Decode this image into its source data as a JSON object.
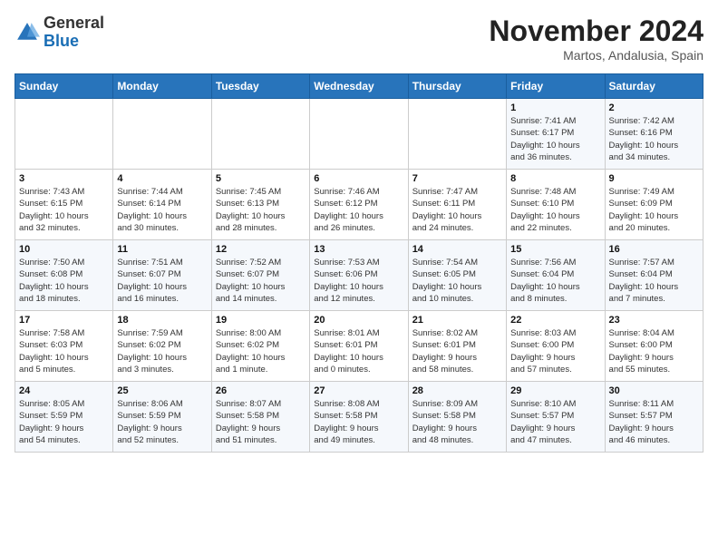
{
  "header": {
    "logo_general": "General",
    "logo_blue": "Blue",
    "month": "November 2024",
    "location": "Martos, Andalusia, Spain"
  },
  "days_of_week": [
    "Sunday",
    "Monday",
    "Tuesday",
    "Wednesday",
    "Thursday",
    "Friday",
    "Saturday"
  ],
  "weeks": [
    [
      {
        "day": "",
        "info": ""
      },
      {
        "day": "",
        "info": ""
      },
      {
        "day": "",
        "info": ""
      },
      {
        "day": "",
        "info": ""
      },
      {
        "day": "",
        "info": ""
      },
      {
        "day": "1",
        "info": "Sunrise: 7:41 AM\nSunset: 6:17 PM\nDaylight: 10 hours\nand 36 minutes."
      },
      {
        "day": "2",
        "info": "Sunrise: 7:42 AM\nSunset: 6:16 PM\nDaylight: 10 hours\nand 34 minutes."
      }
    ],
    [
      {
        "day": "3",
        "info": "Sunrise: 7:43 AM\nSunset: 6:15 PM\nDaylight: 10 hours\nand 32 minutes."
      },
      {
        "day": "4",
        "info": "Sunrise: 7:44 AM\nSunset: 6:14 PM\nDaylight: 10 hours\nand 30 minutes."
      },
      {
        "day": "5",
        "info": "Sunrise: 7:45 AM\nSunset: 6:13 PM\nDaylight: 10 hours\nand 28 minutes."
      },
      {
        "day": "6",
        "info": "Sunrise: 7:46 AM\nSunset: 6:12 PM\nDaylight: 10 hours\nand 26 minutes."
      },
      {
        "day": "7",
        "info": "Sunrise: 7:47 AM\nSunset: 6:11 PM\nDaylight: 10 hours\nand 24 minutes."
      },
      {
        "day": "8",
        "info": "Sunrise: 7:48 AM\nSunset: 6:10 PM\nDaylight: 10 hours\nand 22 minutes."
      },
      {
        "day": "9",
        "info": "Sunrise: 7:49 AM\nSunset: 6:09 PM\nDaylight: 10 hours\nand 20 minutes."
      }
    ],
    [
      {
        "day": "10",
        "info": "Sunrise: 7:50 AM\nSunset: 6:08 PM\nDaylight: 10 hours\nand 18 minutes."
      },
      {
        "day": "11",
        "info": "Sunrise: 7:51 AM\nSunset: 6:07 PM\nDaylight: 10 hours\nand 16 minutes."
      },
      {
        "day": "12",
        "info": "Sunrise: 7:52 AM\nSunset: 6:07 PM\nDaylight: 10 hours\nand 14 minutes."
      },
      {
        "day": "13",
        "info": "Sunrise: 7:53 AM\nSunset: 6:06 PM\nDaylight: 10 hours\nand 12 minutes."
      },
      {
        "day": "14",
        "info": "Sunrise: 7:54 AM\nSunset: 6:05 PM\nDaylight: 10 hours\nand 10 minutes."
      },
      {
        "day": "15",
        "info": "Sunrise: 7:56 AM\nSunset: 6:04 PM\nDaylight: 10 hours\nand 8 minutes."
      },
      {
        "day": "16",
        "info": "Sunrise: 7:57 AM\nSunset: 6:04 PM\nDaylight: 10 hours\nand 7 minutes."
      }
    ],
    [
      {
        "day": "17",
        "info": "Sunrise: 7:58 AM\nSunset: 6:03 PM\nDaylight: 10 hours\nand 5 minutes."
      },
      {
        "day": "18",
        "info": "Sunrise: 7:59 AM\nSunset: 6:02 PM\nDaylight: 10 hours\nand 3 minutes."
      },
      {
        "day": "19",
        "info": "Sunrise: 8:00 AM\nSunset: 6:02 PM\nDaylight: 10 hours\nand 1 minute."
      },
      {
        "day": "20",
        "info": "Sunrise: 8:01 AM\nSunset: 6:01 PM\nDaylight: 10 hours\nand 0 minutes."
      },
      {
        "day": "21",
        "info": "Sunrise: 8:02 AM\nSunset: 6:01 PM\nDaylight: 9 hours\nand 58 minutes."
      },
      {
        "day": "22",
        "info": "Sunrise: 8:03 AM\nSunset: 6:00 PM\nDaylight: 9 hours\nand 57 minutes."
      },
      {
        "day": "23",
        "info": "Sunrise: 8:04 AM\nSunset: 6:00 PM\nDaylight: 9 hours\nand 55 minutes."
      }
    ],
    [
      {
        "day": "24",
        "info": "Sunrise: 8:05 AM\nSunset: 5:59 PM\nDaylight: 9 hours\nand 54 minutes."
      },
      {
        "day": "25",
        "info": "Sunrise: 8:06 AM\nSunset: 5:59 PM\nDaylight: 9 hours\nand 52 minutes."
      },
      {
        "day": "26",
        "info": "Sunrise: 8:07 AM\nSunset: 5:58 PM\nDaylight: 9 hours\nand 51 minutes."
      },
      {
        "day": "27",
        "info": "Sunrise: 8:08 AM\nSunset: 5:58 PM\nDaylight: 9 hours\nand 49 minutes."
      },
      {
        "day": "28",
        "info": "Sunrise: 8:09 AM\nSunset: 5:58 PM\nDaylight: 9 hours\nand 48 minutes."
      },
      {
        "day": "29",
        "info": "Sunrise: 8:10 AM\nSunset: 5:57 PM\nDaylight: 9 hours\nand 47 minutes."
      },
      {
        "day": "30",
        "info": "Sunrise: 8:11 AM\nSunset: 5:57 PM\nDaylight: 9 hours\nand 46 minutes."
      }
    ]
  ]
}
